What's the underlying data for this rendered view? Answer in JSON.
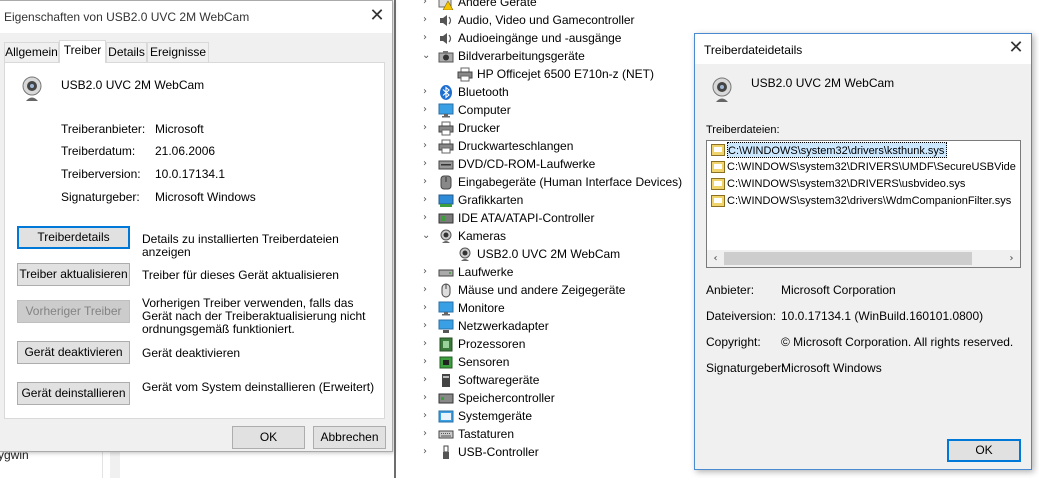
{
  "props_dialog": {
    "title": "Eigenschaften von USB2.0 UVC 2M WebCam",
    "tabs": [
      "Allgemein",
      "Treiber",
      "Details",
      "Ereignisse"
    ],
    "active_tab": "Treiber",
    "device_name": "USB2.0 UVC 2M WebCam",
    "fields": [
      {
        "label": "Treiberanbieter:",
        "value": "Microsoft"
      },
      {
        "label": "Treiberdatum:",
        "value": "21.06.2006"
      },
      {
        "label": "Treiberversion:",
        "value": "10.0.17134.1"
      },
      {
        "label": "Signaturgeber:",
        "value": "Microsoft Windows"
      }
    ],
    "actions": [
      {
        "button": "Treiberdetails",
        "desc": "Details zu installierten Treiberdateien anzeigen",
        "enabled": true
      },
      {
        "button": "Treiber aktualisieren",
        "desc": "Treiber für dieses Gerät aktualisieren",
        "enabled": true
      },
      {
        "button": "Vorheriger Treiber",
        "desc": "Vorherigen Treiber verwenden, falls das Gerät nach der Treiberaktualisierung nicht ordnungsgemäß funktioniert.",
        "enabled": false
      },
      {
        "button": "Gerät deaktivieren",
        "desc": "Gerät deaktivieren",
        "enabled": true
      },
      {
        "button": "Gerät deinstallieren",
        "desc": "Gerät vom System deinstallieren (Erweitert)",
        "enabled": true
      }
    ],
    "ok_label": "OK",
    "cancel_label": "Abbrechen"
  },
  "background": {
    "partial_text": "ygwin"
  },
  "device_tree": [
    {
      "label": "Andere Geräte",
      "expanded": false,
      "level": 0,
      "icon": "warning-device-icon"
    },
    {
      "label": "Audio, Video und Gamecontroller",
      "expanded": false,
      "level": 0,
      "icon": "speaker-icon"
    },
    {
      "label": "Audioeingänge und -ausgänge",
      "expanded": false,
      "level": 0,
      "icon": "speaker-icon"
    },
    {
      "label": "Bildverarbeitungsgeräte",
      "expanded": true,
      "level": 0,
      "icon": "camera-imaging-icon"
    },
    {
      "label": "HP Officejet 6500 E710n-z (NET)",
      "expanded": null,
      "level": 1,
      "icon": "printer-icon"
    },
    {
      "label": "Bluetooth",
      "expanded": false,
      "level": 0,
      "icon": "bluetooth-icon"
    },
    {
      "label": "Computer",
      "expanded": false,
      "level": 0,
      "icon": "monitor-icon"
    },
    {
      "label": "Drucker",
      "expanded": false,
      "level": 0,
      "icon": "printer-icon"
    },
    {
      "label": "Druckwarteschlangen",
      "expanded": false,
      "level": 0,
      "icon": "printer-icon"
    },
    {
      "label": "DVD/CD-ROM-Laufwerke",
      "expanded": false,
      "level": 0,
      "icon": "disc-icon"
    },
    {
      "label": "Eingabegeräte (Human Interface Devices)",
      "expanded": false,
      "level": 0,
      "icon": "hid-icon"
    },
    {
      "label": "Grafikkarten",
      "expanded": false,
      "level": 0,
      "icon": "display-adapter-icon"
    },
    {
      "label": "IDE ATA/ATAPI-Controller",
      "expanded": false,
      "level": 0,
      "icon": "controller-icon"
    },
    {
      "label": "Kameras",
      "expanded": true,
      "level": 0,
      "icon": "webcam-icon"
    },
    {
      "label": "USB2.0 UVC 2M WebCam",
      "expanded": null,
      "level": 1,
      "icon": "webcam-icon"
    },
    {
      "label": "Laufwerke",
      "expanded": false,
      "level": 0,
      "icon": "drive-icon"
    },
    {
      "label": "Mäuse und andere Zeigegeräte",
      "expanded": false,
      "level": 0,
      "icon": "mouse-icon"
    },
    {
      "label": "Monitore",
      "expanded": false,
      "level": 0,
      "icon": "monitor-icon"
    },
    {
      "label": "Netzwerkadapter",
      "expanded": false,
      "level": 0,
      "icon": "network-icon"
    },
    {
      "label": "Prozessoren",
      "expanded": false,
      "level": 0,
      "icon": "cpu-icon"
    },
    {
      "label": "Sensoren",
      "expanded": false,
      "level": 0,
      "icon": "sensor-icon"
    },
    {
      "label": "Softwaregeräte",
      "expanded": false,
      "level": 0,
      "icon": "software-device-icon"
    },
    {
      "label": "Speichercontroller",
      "expanded": false,
      "level": 0,
      "icon": "storage-icon"
    },
    {
      "label": "Systemgeräte",
      "expanded": false,
      "level": 0,
      "icon": "system-icon"
    },
    {
      "label": "Tastaturen",
      "expanded": false,
      "level": 0,
      "icon": "keyboard-icon"
    },
    {
      "label": "USB-Controller",
      "expanded": false,
      "level": 0,
      "icon": "usb-icon"
    }
  ],
  "details_dialog": {
    "title": "Treiberdateidetails",
    "device_name": "USB2.0 UVC 2M WebCam",
    "files_label": "Treiberdateien:",
    "files": [
      "C:\\WINDOWS\\system32\\drivers\\ksthunk.sys",
      "C:\\WINDOWS\\system32\\DRIVERS\\UMDF\\SecureUSBVide",
      "C:\\WINDOWS\\system32\\DRIVERS\\usbvideo.sys",
      "C:\\WINDOWS\\system32\\drivers\\WdmCompanionFilter.sys"
    ],
    "selected_file": 0,
    "fields": [
      {
        "label": "Anbieter:",
        "value": "Microsoft Corporation"
      },
      {
        "label": "Dateiversion:",
        "value": "10.0.17134.1 (WinBuild.160101.0800)"
      },
      {
        "label": "Copyright:",
        "value": "© Microsoft Corporation. All rights reserved."
      },
      {
        "label": "Signaturgeber:",
        "value": "Microsoft Windows"
      }
    ],
    "ok_label": "OK"
  },
  "colors": {
    "accent": "#0078d7",
    "selection": "#cce8ff",
    "dialog_bg": "#f0f0f0"
  }
}
